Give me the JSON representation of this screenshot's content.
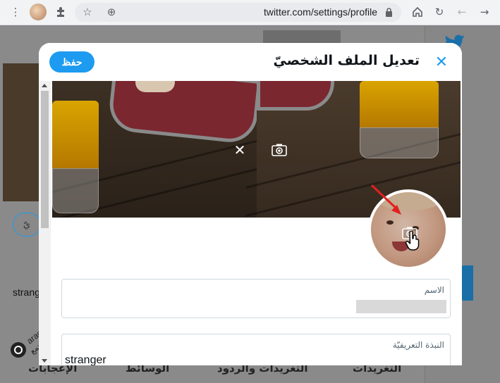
{
  "browser": {
    "url": "twitter.com/settings/profile",
    "icons": [
      "menu-dots-icon",
      "extensions-icon",
      "star-icon",
      "zoom-icon",
      "lock-icon",
      "home-icon",
      "reload-icon",
      "back-icon",
      "forward-icon"
    ]
  },
  "background": {
    "tabs": [
      "الإعجابات",
      "الوسائط",
      "التغريدات والردود",
      "التغريدات"
    ],
    "button_partial": "يّ",
    "username_partial": "strang"
  },
  "watermark": {
    "brand": "arageek",
    "subtitle": "مجتمع"
  },
  "modal": {
    "title": "تعديل الملف الشخصيّ",
    "save_label": "حفظ",
    "fields": {
      "name_label": "الاسم",
      "bio_label": "النبذة التعريفيّة",
      "bio_value": "stranger"
    }
  },
  "colors": {
    "accent": "#1d9bf0",
    "arrow": "#e02020"
  }
}
